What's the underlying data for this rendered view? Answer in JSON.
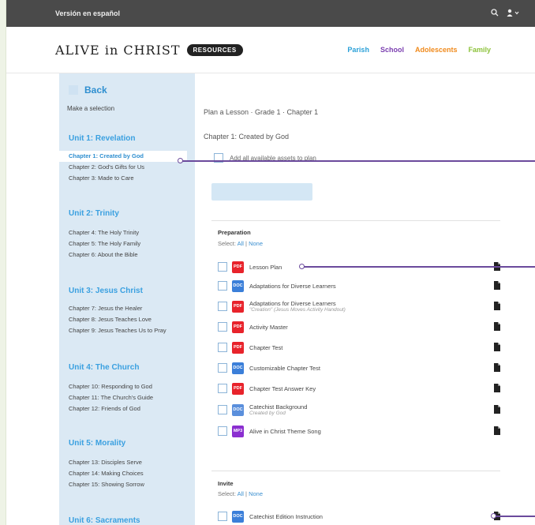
{
  "topbar": {
    "lang_link": "Versión en español"
  },
  "header": {
    "logo": "ALIVE in CHRIST",
    "logo_badge": "RESOURCES",
    "nav": [
      {
        "label": "Parish",
        "color": "#2aa0d8"
      },
      {
        "label": "School",
        "color": "#7b3fb0"
      },
      {
        "label": "Adolescents",
        "color": "#f08a1c"
      },
      {
        "label": "Family",
        "color": "#8cc23a"
      }
    ]
  },
  "sidebar": {
    "back_label": "Back",
    "make_selection": "Make a selection",
    "units": [
      {
        "title": "Unit 1: Revelation",
        "chapters": [
          "Chapter 1: Created by God",
          "Chapter 2: God's Gifts for Us",
          "Chapter 3: Made to Care"
        ]
      },
      {
        "title": "Unit 2: Trinity",
        "chapters": [
          "Chapter 4: The Holy Trinity",
          "Chapter 5: The Holy Family",
          "Chapter 6: About the Bible"
        ]
      },
      {
        "title": "Unit 3: Jesus Christ",
        "chapters": [
          "Chapter 7: Jesus the Healer",
          "Chapter 8: Jesus Teaches Love",
          "Chapter 9: Jesus Teaches Us to Pray"
        ]
      },
      {
        "title": "Unit 4: The Church",
        "chapters": [
          "Chapter 10: Responding to God",
          "Chapter 11: The Church's Guide",
          "Chapter 12: Friends of God"
        ]
      },
      {
        "title": "Unit 5: Morality",
        "chapters": [
          "Chapter 13: Disciples Serve",
          "Chapter 14: Making Choices",
          "Chapter 15: Showing Sorrow"
        ]
      },
      {
        "title": "Unit 6: Sacraments",
        "chapters": []
      }
    ]
  },
  "main": {
    "breadcrumb": "Plan a Lesson · Grade 1 · Chapter 1",
    "subtitle": "Chapter 1: Created by God",
    "add_all": "Add all available assets to plan",
    "sections": [
      {
        "title": "Preparation",
        "select_prefix": "Select:",
        "all": "All",
        "sep": "|",
        "none": "None",
        "items": [
          {
            "type": "PDF",
            "color": "#e8232b",
            "title": "Lesson Plan",
            "sub": ""
          },
          {
            "type": "DOC",
            "color": "#3b7fd9",
            "title": "Adaptations for Diverse Learners",
            "sub": ""
          },
          {
            "type": "PDF",
            "color": "#e8232b",
            "title": "Adaptations for Diverse Learners",
            "sub": "\"Creation\" (Jesus Moves Activity Handout)"
          },
          {
            "type": "PDF",
            "color": "#e8232b",
            "title": "Activity Master",
            "sub": ""
          },
          {
            "type": "PDF",
            "color": "#e8232b",
            "title": "Chapter Test",
            "sub": ""
          },
          {
            "type": "DOC",
            "color": "#3b7fd9",
            "title": "Customizable Chapter Test",
            "sub": ""
          },
          {
            "type": "PDF",
            "color": "#e8232b",
            "title": "Chapter Test Answer Key",
            "sub": ""
          },
          {
            "type": "DOC",
            "color": "#5a8fdc",
            "title": "Catechist Background",
            "sub": "Created by God"
          },
          {
            "type": "MP3",
            "color": "#8b2fd0",
            "title": "Alive in Christ Theme Song",
            "sub": ""
          }
        ]
      },
      {
        "title": "Invite",
        "select_prefix": "Select:",
        "all": "All",
        "sep": "|",
        "none": "None",
        "items": [
          {
            "type": "DOC",
            "color": "#3b7fd9",
            "title": "Catechist Edition Instruction",
            "sub": ""
          }
        ]
      }
    ]
  }
}
